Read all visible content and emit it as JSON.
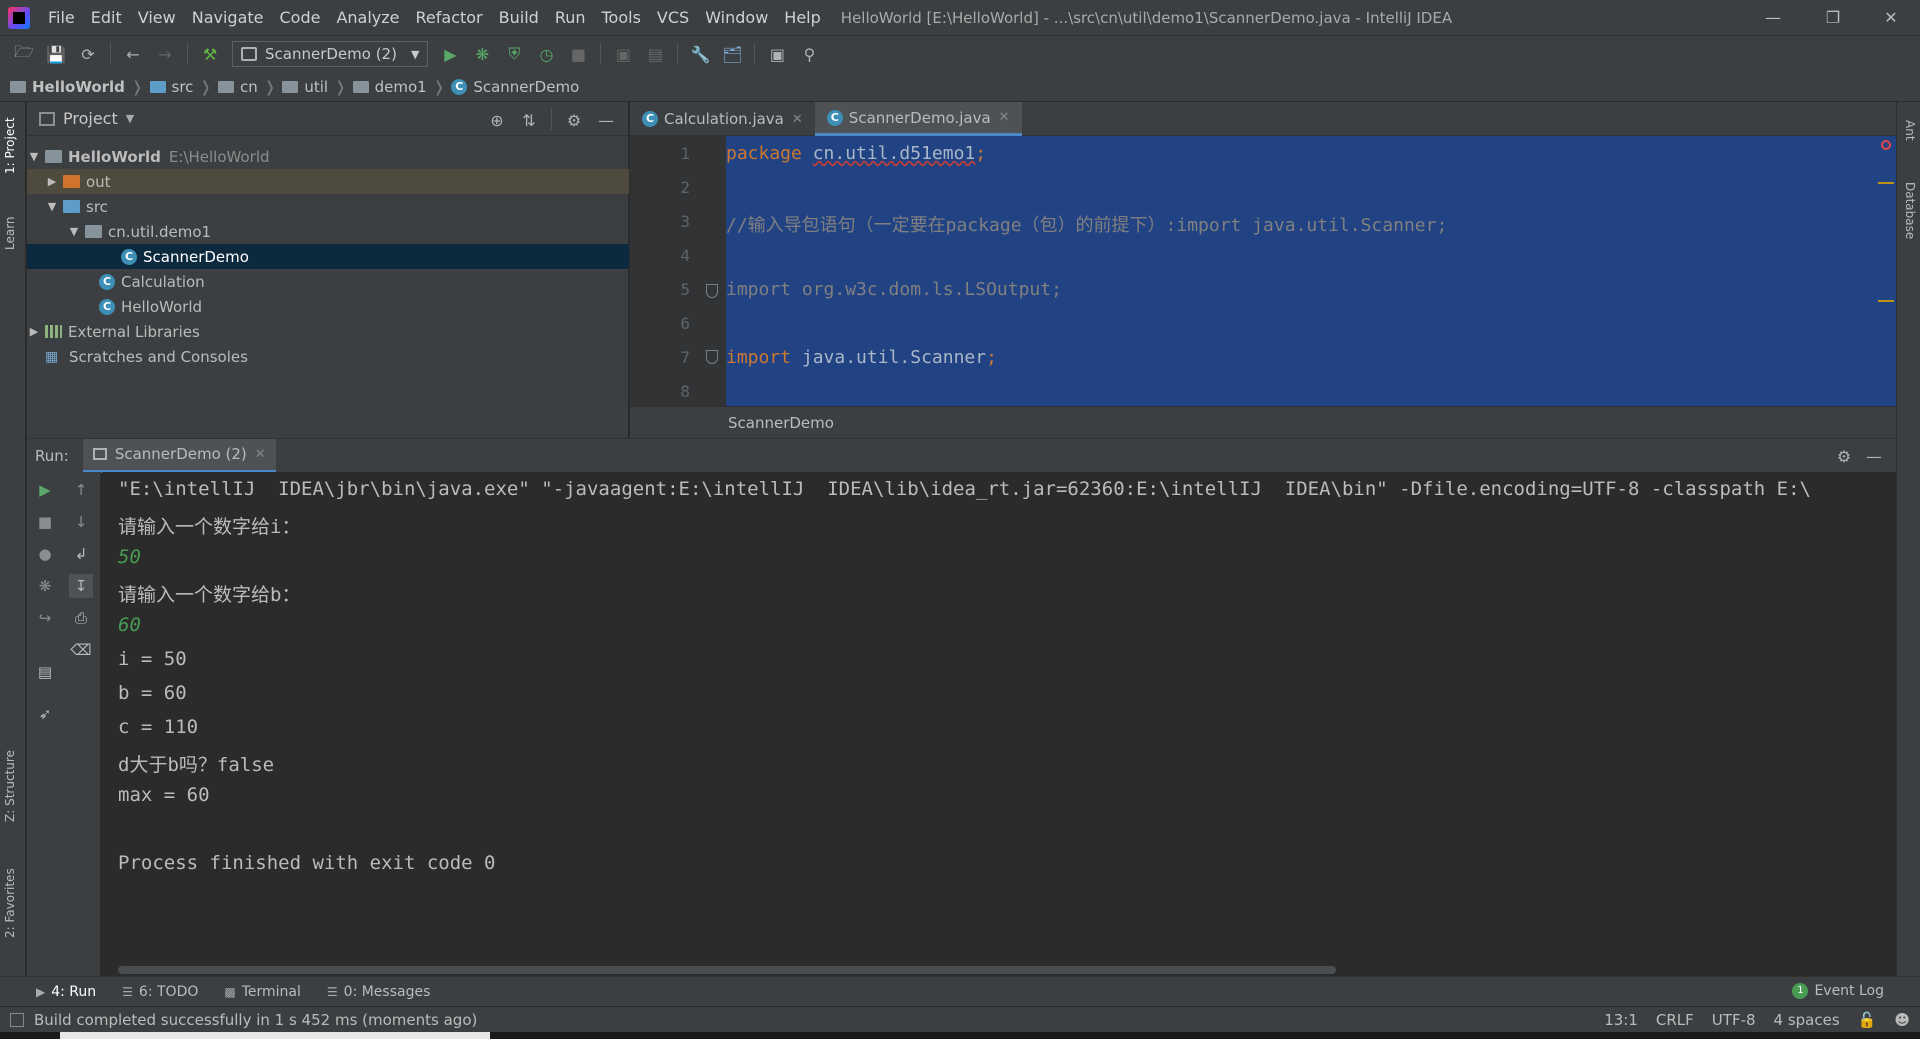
{
  "window": {
    "title": "HelloWorld [E:\\HelloWorld] - ...\\src\\cn\\util\\demo1\\ScannerDemo.java - IntelliJ IDEA"
  },
  "menu": [
    "File",
    "Edit",
    "View",
    "Navigate",
    "Code",
    "Analyze",
    "Refactor",
    "Build",
    "Run",
    "Tools",
    "VCS",
    "Window",
    "Help"
  ],
  "toolbar": {
    "run_config": "ScannerDemo (2)"
  },
  "breadcrumbs": [
    "HelloWorld",
    "src",
    "cn",
    "util",
    "demo1",
    "ScannerDemo"
  ],
  "left_stripe": [
    "1: Project",
    "Learn",
    "Z: Structure",
    "2: Favorites"
  ],
  "right_stripe": [
    "Ant",
    "Database"
  ],
  "project": {
    "title": "Project",
    "tree": [
      {
        "label": "HelloWorld",
        "path": "E:\\HelloWorld",
        "type": "module"
      },
      {
        "label": "out",
        "type": "folder-out"
      },
      {
        "label": "src",
        "type": "folder-src"
      },
      {
        "label": "cn.util.demo1",
        "type": "package"
      },
      {
        "label": "ScannerDemo",
        "type": "class"
      },
      {
        "label": "Calculation",
        "type": "class"
      },
      {
        "label": "HelloWorld",
        "type": "class"
      },
      {
        "label": "External Libraries",
        "type": "library"
      },
      {
        "label": "Scratches and Consoles",
        "type": "scratches"
      }
    ]
  },
  "editor": {
    "tabs": [
      {
        "label": "Calculation.java",
        "active": false
      },
      {
        "label": "ScannerDemo.java",
        "active": true
      }
    ],
    "line_numbers": [
      "1",
      "2",
      "3",
      "4",
      "5",
      "6",
      "7",
      "8"
    ],
    "code": {
      "l1_kw": "package ",
      "l1_pkg": "cn.util.d51emo1",
      "l1_semi": ";",
      "l3": "//输入导包语句（一定要在package（包）的前提下）:import java.util.Scanner;",
      "l5": "import org.w3c.dom.ls.LSOutput;",
      "l7_kw": "import ",
      "l7_rest": "java.util.Scanner",
      "l7_semi": ";"
    },
    "breadcrumb": "ScannerDemo"
  },
  "run": {
    "label": "Run:",
    "tab": "ScannerDemo (2)",
    "console": [
      {
        "text": "\"E:\\intellIJ  IDEA\\jbr\\bin\\java.exe\" \"-javaagent:E:\\intellIJ  IDEA\\lib\\idea_rt.jar=62360:E:\\intellIJ  IDEA\\bin\" -Dfile.encoding=UTF-8 -classpath E:\\",
        "kind": "out"
      },
      {
        "text": "请输入一个数字给i：",
        "kind": "out"
      },
      {
        "text": "50",
        "kind": "input"
      },
      {
        "text": "请输入一个数字给b：",
        "kind": "out"
      },
      {
        "text": "60",
        "kind": "input"
      },
      {
        "text": "i = 50",
        "kind": "out"
      },
      {
        "text": "b = 60",
        "kind": "out"
      },
      {
        "text": "c = 110",
        "kind": "out"
      },
      {
        "text": "d大于b吗？false",
        "kind": "out"
      },
      {
        "text": "max = 60",
        "kind": "out"
      },
      {
        "text": "",
        "kind": "out"
      },
      {
        "text": "Process finished with exit code 0",
        "kind": "out"
      }
    ]
  },
  "bottom_tabs": [
    {
      "label": "4: Run",
      "active": true
    },
    {
      "label": "6: TODO",
      "active": false
    },
    {
      "label": "Terminal",
      "active": false
    },
    {
      "label": "0: Messages",
      "active": false
    }
  ],
  "event_log": {
    "label": "Event Log",
    "count": "1"
  },
  "status": {
    "message": "Build completed successfully in 1 s 452 ms (moments ago)",
    "position": "13:1",
    "line_sep": "CRLF",
    "encoding": "UTF-8",
    "indent": "4 spaces"
  },
  "colors": {
    "selection": "#214283",
    "keyword": "#cc7832",
    "comment": "#808080",
    "input_text": "#499c54",
    "accent": "#4a88c7"
  }
}
